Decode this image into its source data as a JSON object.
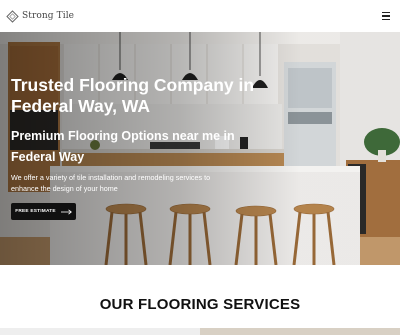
{
  "header": {
    "logo_text": "Strong Tile",
    "logo_icon": "tile-diamond-icon",
    "menu_icon": "hamburger-menu-icon"
  },
  "hero": {
    "title": "Trusted Flooring Company in Federal Way, WA",
    "subtitle": "Premium Flooring Options near me in Federal Way",
    "description": "We offer a variety of tile installation and remodeling services to enhance the design of your home",
    "cta_label": "FREE ESTIMATE",
    "cta_icon": "arrow-right-icon"
  },
  "services": {
    "title": "OUR FLOORING SERVICES"
  },
  "colors": {
    "cta_background": "#111111",
    "header_background": "#ffffff",
    "wood_accent": "#b8864e"
  }
}
